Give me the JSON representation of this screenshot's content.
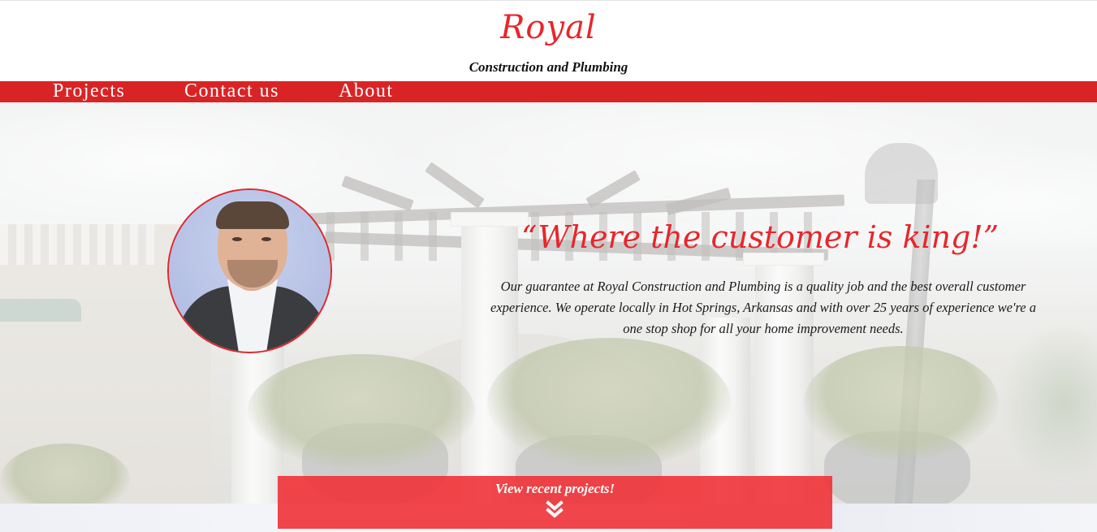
{
  "header": {
    "brand": "Royal",
    "tagline": "Construction and Plumbing"
  },
  "nav": {
    "items": [
      {
        "label": "Projects"
      },
      {
        "label": "Contact us"
      },
      {
        "label": "About"
      }
    ]
  },
  "hero": {
    "slogan": "“Where the customer is king!”",
    "intro": "Our guarantee at Royal Construction and Plumbing is a quality job and the best overall customer experience. We operate locally in Hot Springs, Arkansas and with over 25 years of experience we're a one stop shop for all your home improvement needs.",
    "cta_label": "View recent projects!",
    "cta_icon": "double-chevron-down-icon"
  },
  "colors": {
    "accent": "#d92426",
    "brand_text": "#e8262b",
    "cta": "#f03237"
  }
}
